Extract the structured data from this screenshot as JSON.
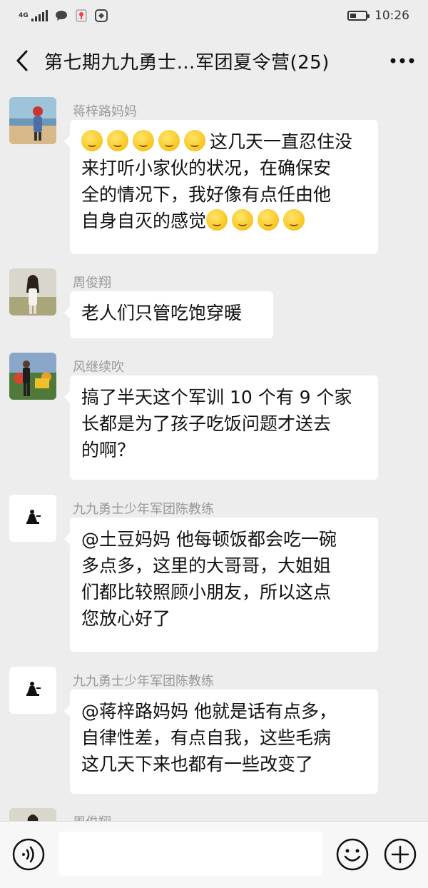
{
  "status": {
    "network": "4G",
    "time": "10:26",
    "battery_level": 0.4
  },
  "header": {
    "title": "第七期九九勇士…军团夏令营(25)",
    "back_icon": "chevron-left-icon",
    "more_icon": "more-icon"
  },
  "messages": [
    {
      "sender": "蒋梓路妈妈",
      "lines": [
        "这几天一直忍住没",
        "来打听小家伙的状况，在确保安",
        "全的情况下，我好像有点任由他",
        "自身自灭的感觉"
      ],
      "emoji_before_first_line": 5,
      "emoji_after_last_line": 4
    },
    {
      "sender": "周俊翔",
      "lines": [
        "老人们只管吃饱穿暖"
      ]
    },
    {
      "sender": "风继续吹",
      "lines": [
        "搞了半天这个军训 10 个有 9 个家",
        "长都是为了孩子吃饭问题才送去",
        "的啊？"
      ]
    },
    {
      "sender": "九九勇士少年军团陈教练",
      "lines": [
        "@土豆妈妈  他每顿饭都会吃一碗",
        "多点多，这里的大哥哥，大姐姐",
        "们都比较照顾小朋友，所以这点",
        "您放心好了"
      ]
    },
    {
      "sender": "九九勇士少年军团陈教练",
      "lines": [
        "@蒋梓路妈妈  他就是话有点多，",
        "自律性差，有点自我，这些毛病",
        "这几天下来也都有一些改变了"
      ]
    },
    {
      "sender": "周俊翔",
      "lines": []
    }
  ],
  "input": {
    "voice_icon": "voice-icon",
    "emoji_icon": "emoji-icon",
    "plus_icon": "plus-icon"
  }
}
